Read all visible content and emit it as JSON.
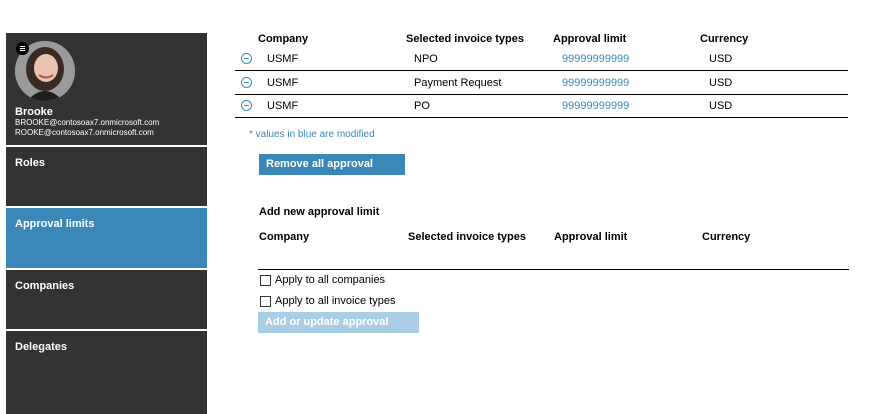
{
  "profile": {
    "name": "Brooke",
    "email_line1": "BROOKE@contosoax7.onmicrosoft.com",
    "email_line2": "ROOKE@contosoax7.onmicrosoft.com"
  },
  "nav": [
    {
      "label": "Roles",
      "active": false
    },
    {
      "label": "Approval limits",
      "active": true
    },
    {
      "label": "Companies",
      "active": false
    },
    {
      "label": "Delegates",
      "active": false
    }
  ],
  "limits_table": {
    "columns": [
      "Company",
      "Selected invoice types",
      "Approval limit",
      "Currency"
    ],
    "rows": [
      {
        "company": "USMF",
        "invoice_type": "NPO",
        "limit": "99999999999",
        "currency": "USD"
      },
      {
        "company": "USMF",
        "invoice_type": "Payment Request",
        "limit": "99999999999",
        "currency": "USD"
      },
      {
        "company": "USMF",
        "invoice_type": "PO",
        "limit": "99999999999",
        "currency": "USD"
      }
    ]
  },
  "modified_note": "* values in blue are modified",
  "remove_all_label": "Remove all approval limits",
  "add_section": {
    "title": "Add new approval limit",
    "columns": [
      "Company",
      "Selected invoice types",
      "Approval limit",
      "Currency"
    ],
    "apply_all_companies": "Apply to all companies",
    "apply_all_invoice_types": "Apply to all invoice types",
    "submit_label": "Add or update approval limits"
  },
  "colors": {
    "sidebar_bg": "#333333",
    "accent": "#3b87b8",
    "disabled_button": "#a9cde5"
  },
  "icons": {
    "menu": "hamburger-icon",
    "row_remove": "minus-circle-icon"
  }
}
